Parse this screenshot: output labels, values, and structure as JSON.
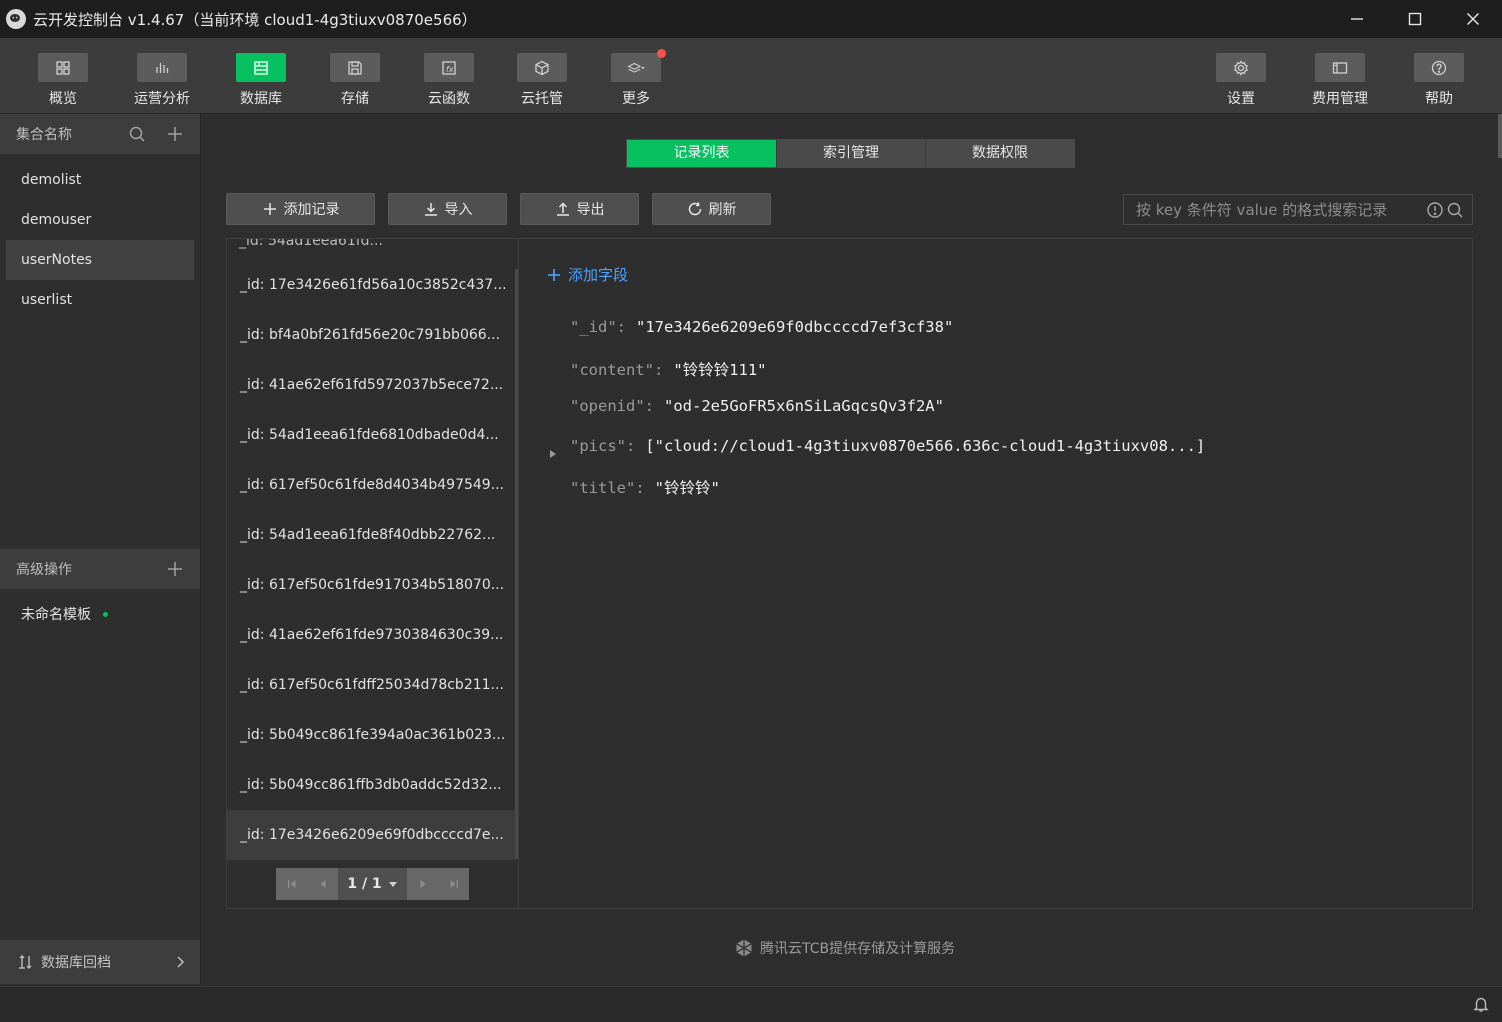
{
  "window": {
    "title": "云开发控制台 v1.4.67（当前环境 cloud1-4g3tiuxv0870e566）"
  },
  "toolbar": {
    "left": [
      {
        "key": "overview",
        "label": "概览",
        "icon": "grid-icon"
      },
      {
        "key": "analytics",
        "label": "运营分析",
        "icon": "bar-chart-icon"
      },
      {
        "key": "database",
        "label": "数据库",
        "icon": "database-icon",
        "active": true
      },
      {
        "key": "storage",
        "label": "存储",
        "icon": "floppy-icon"
      },
      {
        "key": "functions",
        "label": "云函数",
        "icon": "function-icon"
      },
      {
        "key": "hosting",
        "label": "云托管",
        "icon": "cube-icon"
      },
      {
        "key": "more",
        "label": "更多",
        "icon": "layers-icon",
        "badge": true
      }
    ],
    "right": [
      {
        "key": "settings",
        "label": "设置",
        "icon": "gear-icon"
      },
      {
        "key": "billing",
        "label": "费用管理",
        "icon": "billing-icon"
      },
      {
        "key": "help",
        "label": "帮助",
        "icon": "help-icon"
      }
    ]
  },
  "sidebar": {
    "collections_header": "集合名称",
    "collections": [
      "demolist",
      "demouser",
      "userNotes",
      "userlist"
    ],
    "selected_collection": "userNotes",
    "advanced_header": "高级操作",
    "template_item": "未命名模板",
    "footer_label": "数据库回档"
  },
  "tabs": [
    "记录列表",
    "索引管理",
    "数据权限"
  ],
  "actions": {
    "add": "添加记录",
    "import": "导入",
    "export": "导出",
    "refresh": "刷新"
  },
  "search": {
    "placeholder": "按 key 条件符 value 的格式搜索记录"
  },
  "records": {
    "cut_top": "_id: 54ad1eea61fd...",
    "items": [
      "_id: 17e3426e61fd56a10c3852c437...",
      "_id: bf4a0bf261fd56e20c791bb066...",
      "_id: 41ae62ef61fd5972037b5ece72...",
      "_id: 54ad1eea61fde6810dbade0d4...",
      "_id: 617ef50c61fde8d4034b497549...",
      "_id: 54ad1eea61fde8f40dbb22762...",
      "_id: 617ef50c61fde917034b518070...",
      "_id: 41ae62ef61fde9730384630c39...",
      "_id: 617ef50c61fdff25034d78cb211...",
      "_id: 5b049cc861fe394a0ac361b023...",
      "_id: 5b049cc861ffb3db0addc52d32...",
      "_id: 17e3426e6209e69f0dbccccd7e..."
    ],
    "selected_index": 11,
    "pager": "1 / 1"
  },
  "detail": {
    "add_field": "添加字段",
    "fields": [
      {
        "key": "\"_id\":",
        "value": "\"17e3426e6209e69f0dbccccd7ef3cf38\""
      },
      {
        "key": "\"content\":",
        "value": "\"铃铃铃111\""
      },
      {
        "key": "\"openid\":",
        "value": "\"od-2e5GoFR5x6nSiLaGqcsQv3f2A\""
      },
      {
        "key": "\"pics\":",
        "value": "[\"cloud://cloud1-4g3tiuxv0870e566.636c-cloud1-4g3tiuxv08...]"
      },
      {
        "key": "\"title\":",
        "value": "\"铃铃铃\""
      }
    ]
  },
  "footer": {
    "brand": "腾讯云TCB提供存储及计算服务"
  },
  "colors": {
    "accent": "#07c160",
    "link": "#4aa3ff",
    "badge": "#fa5151"
  }
}
